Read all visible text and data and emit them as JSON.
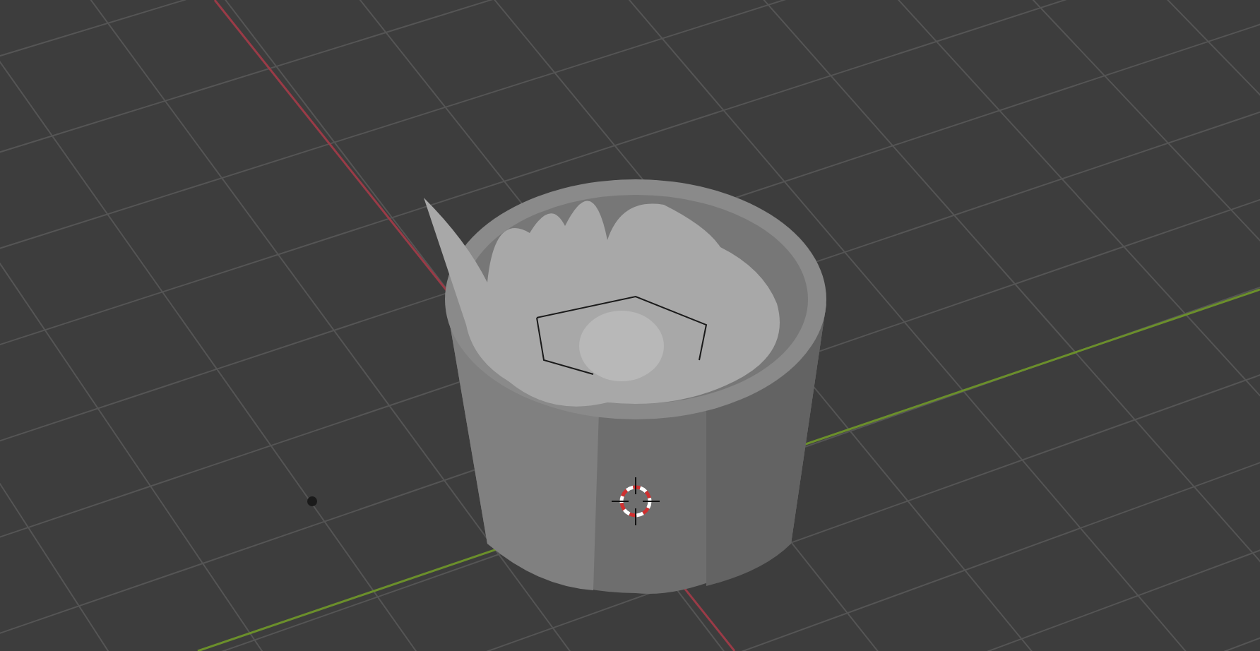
{
  "viewport": {
    "show_grid": true,
    "show_axes": true
  }
}
